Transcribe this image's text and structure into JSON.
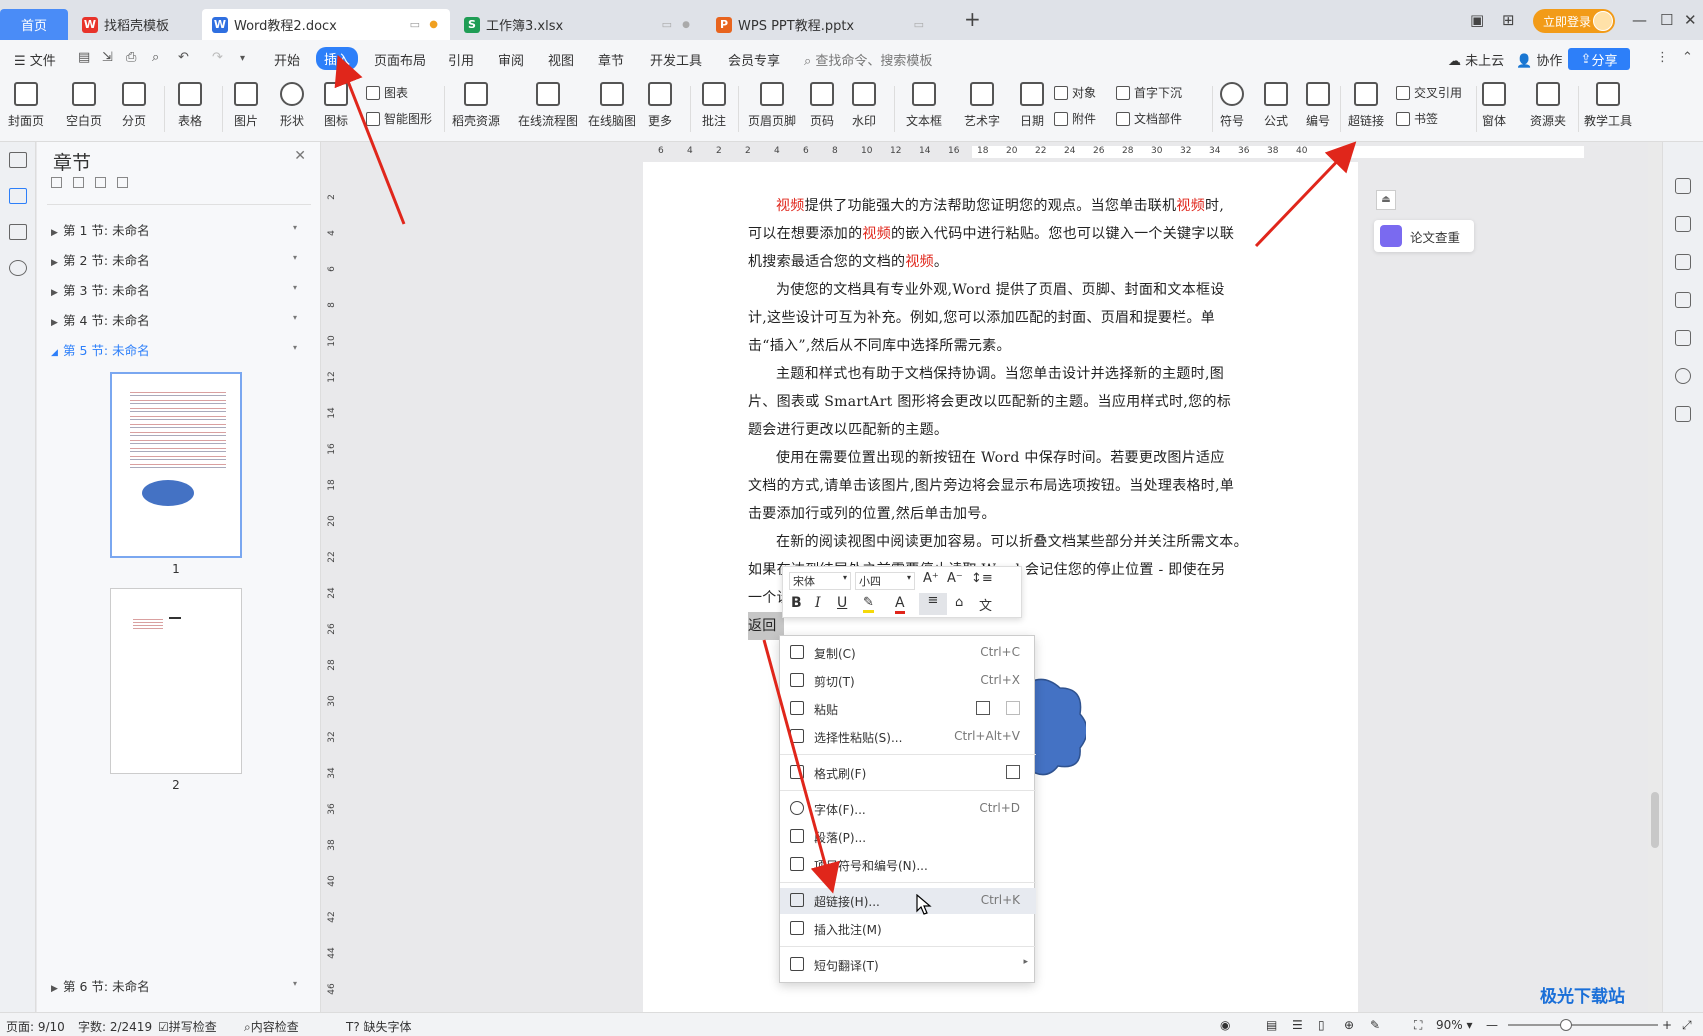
{
  "tabs": {
    "home": "首页",
    "items": [
      {
        "label": "找稻壳模板",
        "icon": "wps-logo-icon"
      },
      {
        "label": "Word教程2.docx",
        "icon": "word-doc-icon"
      },
      {
        "label": "工作簿3.xlsx",
        "icon": "excel-sheet-icon"
      },
      {
        "label": "WPS PPT教程.pptx",
        "icon": "ppt-icon"
      }
    ],
    "add": "+",
    "login": "立即登录"
  },
  "menubar": {
    "file": "文件",
    "items": [
      "开始",
      "插入",
      "页面布局",
      "引用",
      "审阅",
      "视图",
      "章节",
      "开发工具",
      "会员专享"
    ],
    "search": "查找命令、搜索模板",
    "cloud": "未上云",
    "collab": "协作",
    "share": "分享"
  },
  "ribbon": {
    "buttons": [
      "封面页",
      "空白页",
      "分页",
      "表格",
      "图片",
      "形状",
      "图标",
      "稻壳资源",
      "在线流程图",
      "在线脑图",
      "更多",
      "批注",
      "页眉页脚",
      "页码",
      "水印",
      "文本框",
      "艺术字",
      "日期",
      "符号",
      "公式",
      "编号",
      "超链接",
      "窗体",
      "资源夹",
      "教学工具"
    ],
    "small": [
      "图表",
      "智能图形",
      "对象",
      "附件",
      "首字下沉",
      "文档部件",
      "交叉引用",
      "书签"
    ]
  },
  "sections": {
    "title": "章节",
    "items": [
      "第 1 节: 未命名",
      "第 2 节: 未命名",
      "第 3 节: 未命名",
      "第 4 节: 未命名",
      "第 5 节: 未命名"
    ],
    "last": "第 6 节: 未命名",
    "pages": [
      "1",
      "2"
    ]
  },
  "ruler": {
    "h": [
      "6",
      "4",
      "2",
      "2",
      "4",
      "6",
      "8",
      "10",
      "12",
      "14",
      "16",
      "18",
      "20",
      "22",
      "24",
      "26",
      "28",
      "30",
      "32",
      "34",
      "36",
      "38",
      "40"
    ],
    "v": [
      "2",
      "4",
      "6",
      "8",
      "10",
      "12",
      "14",
      "16",
      "18",
      "20",
      "22",
      "24",
      "26",
      "28",
      "30",
      "32",
      "34",
      "36",
      "38",
      "40",
      "42",
      "44",
      "46"
    ]
  },
  "document": {
    "p1": [
      "视频",
      "提供了功能强大的方法帮助您证明您的观点。当您单击联机",
      "视频",
      "时,可以在想要添加的",
      "视频",
      "的嵌入代码中进行粘贴。您也可以键入一个关键字以联机搜索最适合您的文档的",
      "视频",
      "。"
    ],
    "p2": "为使您的文档具有专业外观,Word 提供了页眉、页脚、封面和文本框设计,这些设计可互为补充。例如,您可以添加匹配的封面、页眉和提要栏。单击“插入”,然后从不同库中选择所需元素。",
    "p3": "主题和样式也有助于文档保持协调。当您单击设计并选择新的主题时,图片、图表或 SmartArt 图形将会更改以匹配新的主题。当应用样式时,您的标题会进行更改以匹配新的主题。",
    "p4": "使用在需要位置出现的新按钮在 Word 中保存时间。若要更改图片适应文档的方式,请单击该图片,图片旁边将会显示布局选项按钮。当处理表格时,单击要添加行或列的位置,然后单击加号。",
    "p5a": "在新的阅读视图中阅读更加容易。可以折叠文档某些部分并关注所需文本。",
    "p5b": "如果在达到结尾处之前需要停止读取,Word 会记住您的停止位置 - 即使在另",
    "p5c": "一个设",
    "selected": "返回"
  },
  "minitoolbar": {
    "font": "宋体",
    "size": "小四"
  },
  "context_menu": [
    {
      "label": "复制(C)",
      "shortcut": "Ctrl+C",
      "icon": "copy-icon"
    },
    {
      "label": "剪切(T)",
      "shortcut": "Ctrl+X",
      "icon": "scissors-icon"
    },
    {
      "label": "粘贴",
      "shortcut": "",
      "icon": "paste-icon"
    },
    {
      "label": "选择性粘贴(S)...",
      "shortcut": "Ctrl+Alt+V",
      "icon": "paste-special-icon"
    },
    {
      "label": "格式刷(F)",
      "shortcut": "",
      "icon": "format-brush-icon"
    },
    {
      "label": "字体(F)...",
      "shortcut": "Ctrl+D",
      "icon": "font-icon"
    },
    {
      "label": "段落(P)...",
      "shortcut": "",
      "icon": "paragraph-icon"
    },
    {
      "label": "项目符号和编号(N)...",
      "shortcut": "",
      "icon": "bullets-icon"
    },
    {
      "label": "超链接(H)...",
      "shortcut": "Ctrl+K",
      "icon": "link-icon"
    },
    {
      "label": "插入批注(M)",
      "shortcut": "",
      "icon": "comment-icon"
    },
    {
      "label": "短句翻译(T)",
      "shortcut": "",
      "icon": "translate-icon"
    }
  ],
  "side": {
    "paper_check": "论文查重"
  },
  "status": {
    "page": "页面: 9/10",
    "words": "字数: 2/2419",
    "spell": "拼写检查",
    "content": "内容检查",
    "font_missing": "缺失字体",
    "zoom": "90%"
  },
  "colors": {
    "accent": "#2d7ff9",
    "highlight": "#e0261b",
    "arrow": "#e0261b",
    "cloud": "#4472c4"
  }
}
